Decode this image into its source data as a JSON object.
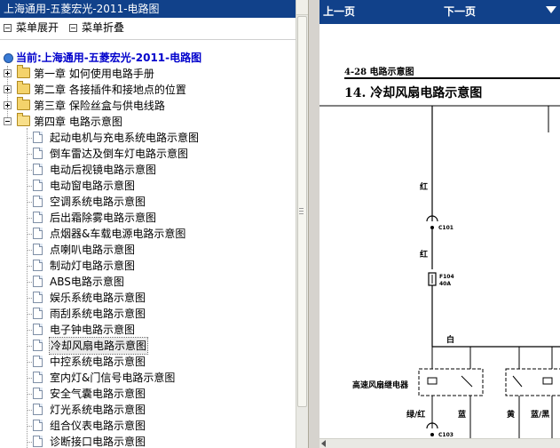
{
  "left_pane": {
    "title": "上海通用-五菱宏光-2011-电路图",
    "toolbar": {
      "expand_label": "菜单展开",
      "collapse_label": "菜单折叠"
    },
    "current_label": "当前:上海通用-五菱宏光-2011-电路图",
    "chapters": [
      {
        "label": "第一章  如何使用电路手册",
        "state": "collapsed"
      },
      {
        "label": "第二章  各接插件和接地点的位置",
        "state": "collapsed"
      },
      {
        "label": "第三章  保险丝盒与供电线路",
        "state": "collapsed"
      },
      {
        "label": "第四章  电路示意图",
        "state": "expanded"
      }
    ],
    "items": [
      "起动电机与充电系统电路示意图",
      "倒车雷达及倒车灯电路示意图",
      "电动后视镜电路示意图",
      "电动窗电路示意图",
      "空调系统电路示意图",
      "后出霜除雾电路示意图",
      "点烟器&车载电源电路示意图",
      "点喇叭电路示意图",
      "制动灯电路示意图",
      "ABS电路示意图",
      "娱乐系统电路示意图",
      "雨刮系统电路示意图",
      "电子钟电路示意图",
      "冷却风扇电路示意图",
      "中控系统电路示意图",
      "室内灯&门信号电路示意图",
      "安全气囊电路示意图",
      "灯光系统电路示意图",
      "组合仪表电路示意图",
      "诊断接口电路示意图"
    ],
    "selected_index": 13,
    "icons": {
      "expand": "minus-box-icon",
      "collapse": "minus-box-icon",
      "current": "globe-icon",
      "chapter": "folder-icon",
      "item": "document-icon"
    }
  },
  "right_pane": {
    "nav": {
      "prev_label": "上一页",
      "next_label": "下一页"
    },
    "document": {
      "page_number": "4-28  电路示意图",
      "title": "14. 冷却风扇电路示意图",
      "labels": {
        "wire_red_1": "红",
        "c101": "C101",
        "wire_red_2": "红",
        "fuse_id": "F104",
        "fuse_rating": "40A",
        "wire_white": "白",
        "relay_high": "高速风扇继电器",
        "wire_green_red": "绿/红",
        "wire_blue": "蓝",
        "wire_yellow": "黄",
        "wire_blue_black": "蓝/黑",
        "c103": "C103"
      }
    }
  },
  "colors": {
    "title_bar": "#11418a",
    "current_link": "#0000cc",
    "splitter": "#d6d3ce"
  }
}
